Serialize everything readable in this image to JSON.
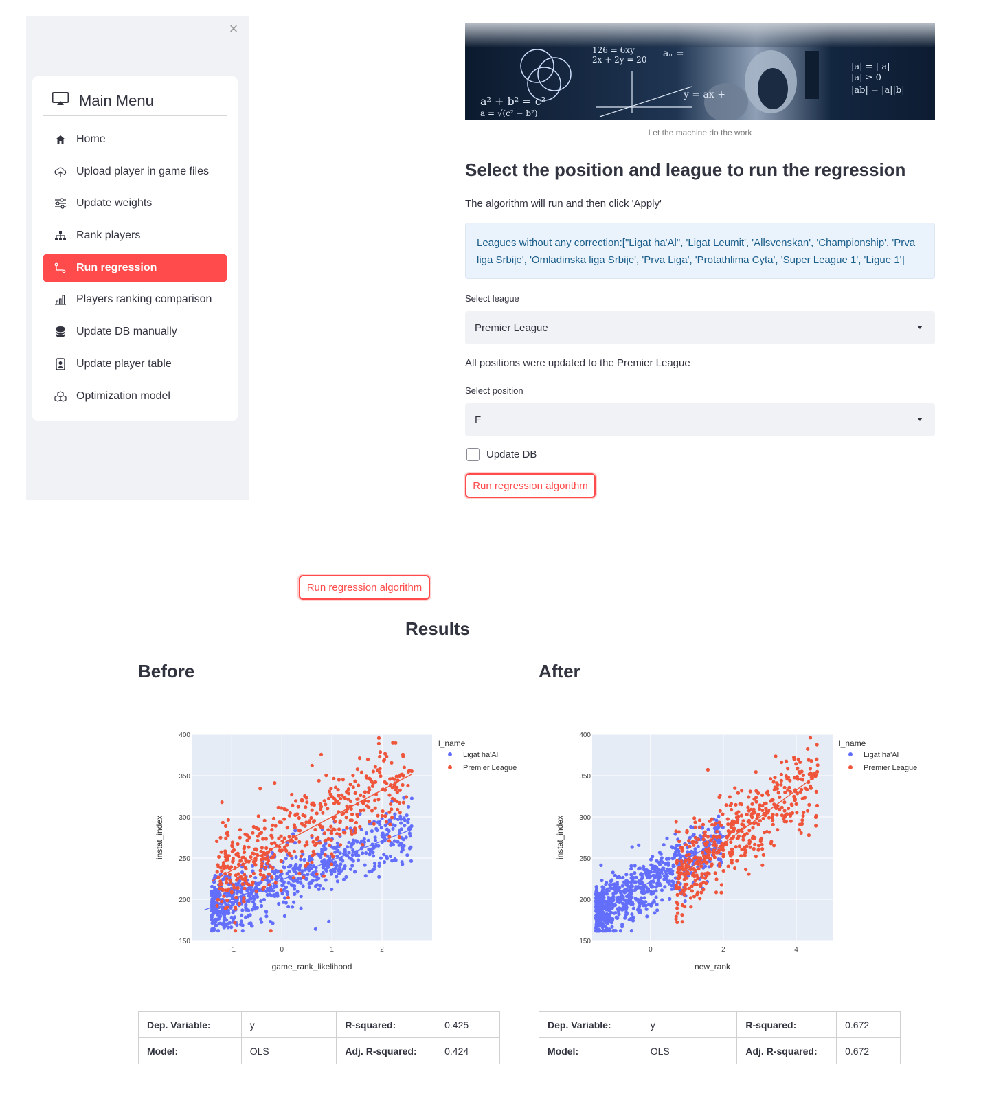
{
  "sidebar": {
    "close_label": "×",
    "menu_title": "Main Menu",
    "items": [
      {
        "label": "Home",
        "icon": "house-icon"
      },
      {
        "label": "Upload player in game files",
        "icon": "cloud-upload-icon"
      },
      {
        "label": "Update weights",
        "icon": "sliders-icon"
      },
      {
        "label": "Rank players",
        "icon": "diagram-icon"
      },
      {
        "label": "Run regression",
        "icon": "regression-icon",
        "active": true
      },
      {
        "label": "Players ranking comparison",
        "icon": "bar-chart-icon"
      },
      {
        "label": "Update DB manually",
        "icon": "database-icon"
      },
      {
        "label": "Update player table",
        "icon": "person-badge-icon"
      },
      {
        "label": "Optimization model",
        "icon": "boxes-icon"
      }
    ],
    "accent_color": "#ff4b4b"
  },
  "main": {
    "banner_alt": "math equations banner image",
    "banner_caption": "Let the machine do the work",
    "heading": "Select the position and league to run the regression",
    "instruction": "The algorithm will run and then click 'Apply'",
    "info_text": "Leagues without any correction:[\"Ligat ha'Al\", 'Ligat Leumit', 'Allsvenskan', 'Championship', 'Prva liga Srbije', 'Omladinska liga Srbije', 'Prva Liga', 'Protathlima Cyta', 'Super League 1', 'Ligue 1']",
    "league_label": "Select league",
    "league_value": "Premier League",
    "league_message": "All positions were updated to the Premier League",
    "position_label": "Select position",
    "position_value": "F",
    "update_db_label": "Update DB",
    "update_db_checked": false,
    "run_button_label": "Run regression algorithm"
  },
  "results": {
    "run_button_label": "Run regression algorithm",
    "title": "Results",
    "before_title": "Before",
    "after_title": "After",
    "before_table": [
      [
        "Dep. Variable:",
        "y",
        "R-squared:",
        "0.425"
      ],
      [
        "Model:",
        "OLS",
        "Adj. R-squared:",
        "0.424"
      ]
    ],
    "after_table": [
      [
        "Dep. Variable:",
        "y",
        "R-squared:",
        "0.672"
      ],
      [
        "Model:",
        "OLS",
        "Adj. R-squared:",
        "0.672"
      ]
    ]
  },
  "chart_data": [
    {
      "type": "scatter",
      "xlabel": "game_rank_likelihood",
      "ylabel": "instat_index",
      "xlim": [
        -1.8,
        3.0
      ],
      "ylim": [
        150,
        400
      ],
      "xticks": [
        -1,
        0,
        1,
        2
      ],
      "yticks": [
        150,
        200,
        250,
        300,
        350,
        400
      ],
      "legend_title": "l_name",
      "legend_position": "top-right outside",
      "series": [
        {
          "name": "Ligat ha'Al",
          "color": "#636efa",
          "x_range": [
            -1.4,
            2.6
          ],
          "y_center": "190 at -1 rising to 285 at 2.6",
          "trend": {
            "x": [
              -1.55,
              2.6
            ],
            "y": [
              187,
              285
            ]
          }
        },
        {
          "name": "Premier League",
          "color": "#ef553b",
          "x_range": [
            -1.3,
            2.6
          ],
          "y_center": "225 at -1.3 rising to 350 at 2.6",
          "trend": {
            "x": [
              -1.4,
              2.6
            ],
            "y": [
              222,
              352
            ]
          }
        }
      ],
      "grid": true
    },
    {
      "type": "scatter",
      "xlabel": "new_rank",
      "ylabel": "instat_index",
      "xlim": [
        -1.6,
        5.0
      ],
      "ylim": [
        150,
        400
      ],
      "xticks": [
        0,
        2,
        4
      ],
      "yticks": [
        150,
        200,
        250,
        300,
        350,
        400
      ],
      "legend_title": "l_name",
      "legend_position": "top-right outside",
      "series": [
        {
          "name": "Ligat ha'Al",
          "color": "#636efa",
          "x_range": [
            -1.5,
            2.0
          ],
          "y_center": "185 at -1.5 rising to 270 at 2",
          "trend": {
            "x": [
              -1.55,
              2.1
            ],
            "y": [
              180,
              278
            ]
          }
        },
        {
          "name": "Premier League",
          "color": "#ef553b",
          "x_range": [
            0.7,
            4.6
          ],
          "y_center": "220 at 0.8 rising to 350 at 4.6",
          "trend": {
            "x": [
              0.7,
              4.6
            ],
            "y": [
              225,
              352
            ]
          }
        }
      ],
      "grid": true
    }
  ]
}
